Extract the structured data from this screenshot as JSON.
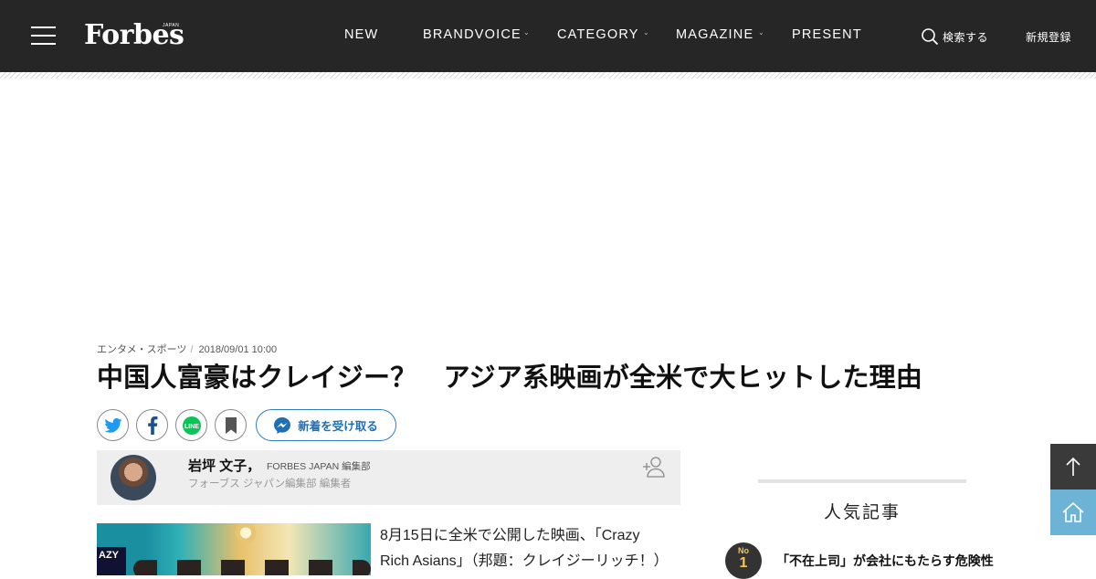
{
  "header": {
    "logo_text": "Forbes",
    "logo_sub": "JAPAN",
    "nav": [
      {
        "label": "NEW",
        "has_dropdown": false
      },
      {
        "label": "BRANDVOICE",
        "has_dropdown": true
      },
      {
        "label": "CATEGORY",
        "has_dropdown": true
      },
      {
        "label": "MAGAZINE",
        "has_dropdown": true
      },
      {
        "label": "PRESENT",
        "has_dropdown": false
      }
    ],
    "search_label": "検索する",
    "register_label": "新規登録",
    "colors": {
      "bar": "#262626",
      "text": "#ffffff"
    }
  },
  "article": {
    "category": "エンタメ・スポーツ",
    "date": "2018/09/01 10:00",
    "title": "中国人富豪はクレイジー？　アジア系映画が全米で大ヒットした理由",
    "share_icons": [
      "twitter-icon",
      "facebook-icon",
      "line-icon",
      "bookmark-icon"
    ],
    "subscribe_label": "新着を受け取る",
    "author": {
      "name": "岩坪 文子，",
      "org": "FORBES JAPAN 編集部",
      "role": "フォーブス ジャパン編集部 編集者"
    },
    "image_sign_text": "AZY",
    "body_lines": [
      "8月15日に全米で公開した映画、「Crazy",
      "Rich Asians」（邦題：クレイジーリッチ！）"
    ]
  },
  "sidebar": {
    "section_title": "人気記事",
    "ranking": [
      {
        "no_label": "No",
        "rank": "1",
        "title": "「不在上司」が会社にもたらす危険性"
      }
    ]
  },
  "floating": {
    "top_icon": "arrow-up-icon",
    "home_icon": "home-icon",
    "colors": {
      "top": "#3a3a3a",
      "home": "#6cb3d6"
    }
  }
}
